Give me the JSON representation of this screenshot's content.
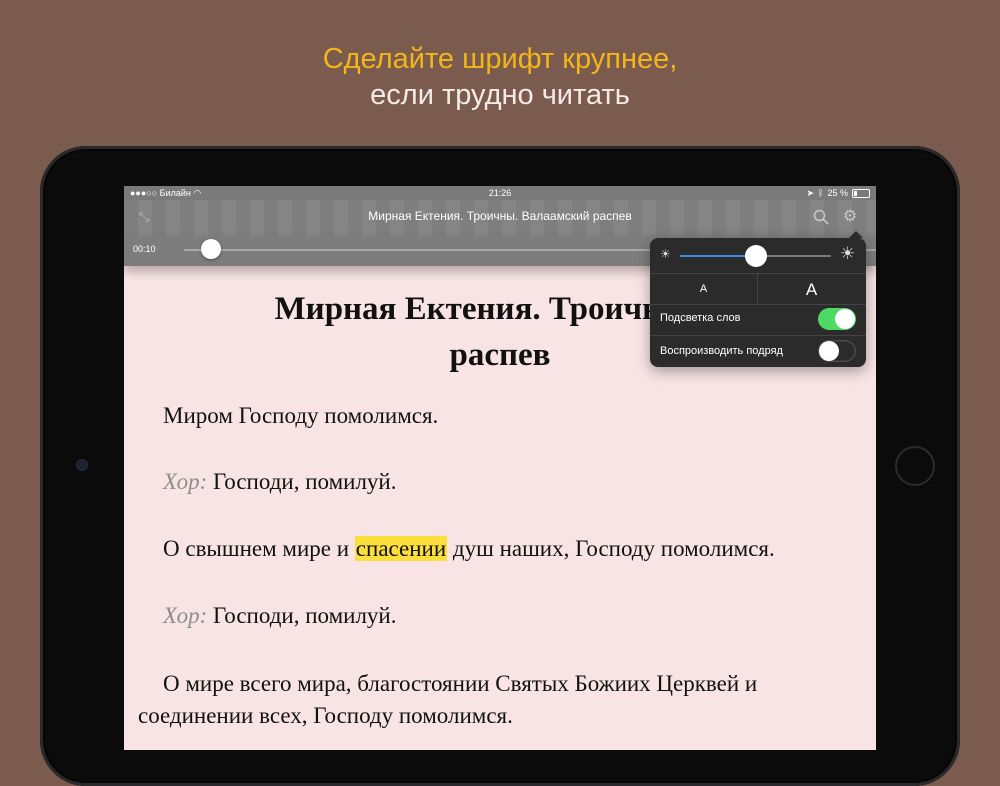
{
  "promo": {
    "line1": "Сделайте шрифт крупнее,",
    "line2": "если трудно читать"
  },
  "colors": {
    "background": "#7c5b4f",
    "promo_accent": "#f2b51b",
    "highlight": "#fbdf3c",
    "toggle_on": "#4cd964",
    "slider_fill": "#3a8de0"
  },
  "statusbar": {
    "carrier": "●●●○○ Билайн",
    "time": "21:26",
    "battery": "25 %"
  },
  "navbar": {
    "title": "Мирная Ектения. Троичны. Валаамский распев",
    "collapse_icon": "collapse-arrows-icon",
    "search_icon": "search-icon",
    "settings_icon": "gear-icon"
  },
  "player": {
    "elapsed": "00:10",
    "progress_fraction": 0.02
  },
  "document": {
    "heading_line1": "Мирная Ектения. Троичны. В",
    "heading_line2": "распев",
    "p1": "Миром Господу помолимся.",
    "p2_choir": "Хор:",
    "p2_text": " Господи, помилуй.",
    "p3_before": "О свышнем мире и ",
    "p3_highlight": "спасении",
    "p3_after": " душ наших, Господу помолимся.",
    "p4_choir": "Хор:",
    "p4_text": " Господи, помилуй.",
    "p5_line1": "О мире всего мира, благостоянии Святых Божиих Церквей и",
    "p5_line2": "соединении всех, Господу помолимся."
  },
  "settings_popover": {
    "brightness_fraction": 0.5,
    "font_smaller_label": "A",
    "font_larger_label": "A",
    "word_highlight_label": "Подсветка слов",
    "word_highlight_on": true,
    "autoplay_label": "Воспроизводить подряд",
    "autoplay_on": false
  }
}
